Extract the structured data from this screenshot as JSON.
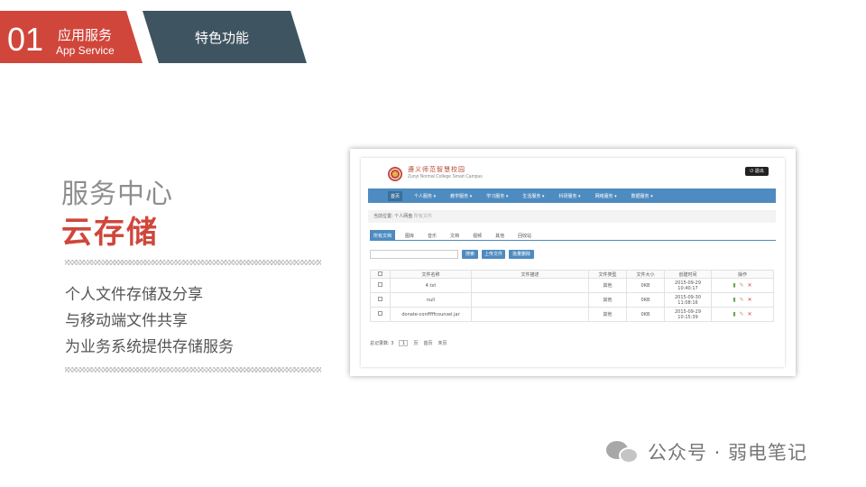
{
  "header": {
    "number": "01",
    "section_cn": "应用服务",
    "section_en": "App Service",
    "feature_tab": "特色功能"
  },
  "left": {
    "subtitle": "服务中心",
    "title": "云存储",
    "features": [
      "个人文件存储及分享",
      "与移动端文件共享",
      "为业务系统提供存储服务"
    ]
  },
  "screenshot": {
    "logo_cn": "遵义师范智慧校园",
    "logo_en": "Zunyi Normal College Smart Campus",
    "exit_label": "⏻ 退出",
    "nav": [
      "首页",
      "个人服务 ▾",
      "教学服务 ▾",
      "学习服务 ▾",
      "生活服务 ▾",
      "科研服务 ▾",
      "网络服务 ▾",
      "数据服务 ▾"
    ],
    "breadcrumb": [
      "当前位置:",
      "个人网盘",
      "所有文件"
    ],
    "tabs": [
      "所有文档",
      "图库",
      "音乐",
      "文档",
      "视频",
      "其他",
      "回收站"
    ],
    "buttons": [
      "搜索",
      "上传文件",
      "批量删除"
    ],
    "columns": [
      "文件名称",
      "文件描述",
      "文件类型",
      "文件大小",
      "创建时间",
      "操作"
    ],
    "rows": [
      {
        "name": "4.txt",
        "desc": "",
        "type": "其他",
        "size": "0KB",
        "date": "2015-09-29",
        "time": "10:40:17"
      },
      {
        "name": "null",
        "desc": "",
        "type": "其他",
        "size": "0KB",
        "date": "2015-09-30",
        "time": "11:08:16"
      },
      {
        "name": "donate-confffffcounsel.jar",
        "desc": "",
        "type": "其他",
        "size": "0KB",
        "date": "2015-09-29",
        "time": "10:15:39"
      }
    ],
    "pager": {
      "label": "总记录数: 3",
      "page": "1",
      "unit": "页",
      "first": "首页",
      "last": "末页"
    }
  },
  "watermark": "公众号 · 弱电笔记"
}
